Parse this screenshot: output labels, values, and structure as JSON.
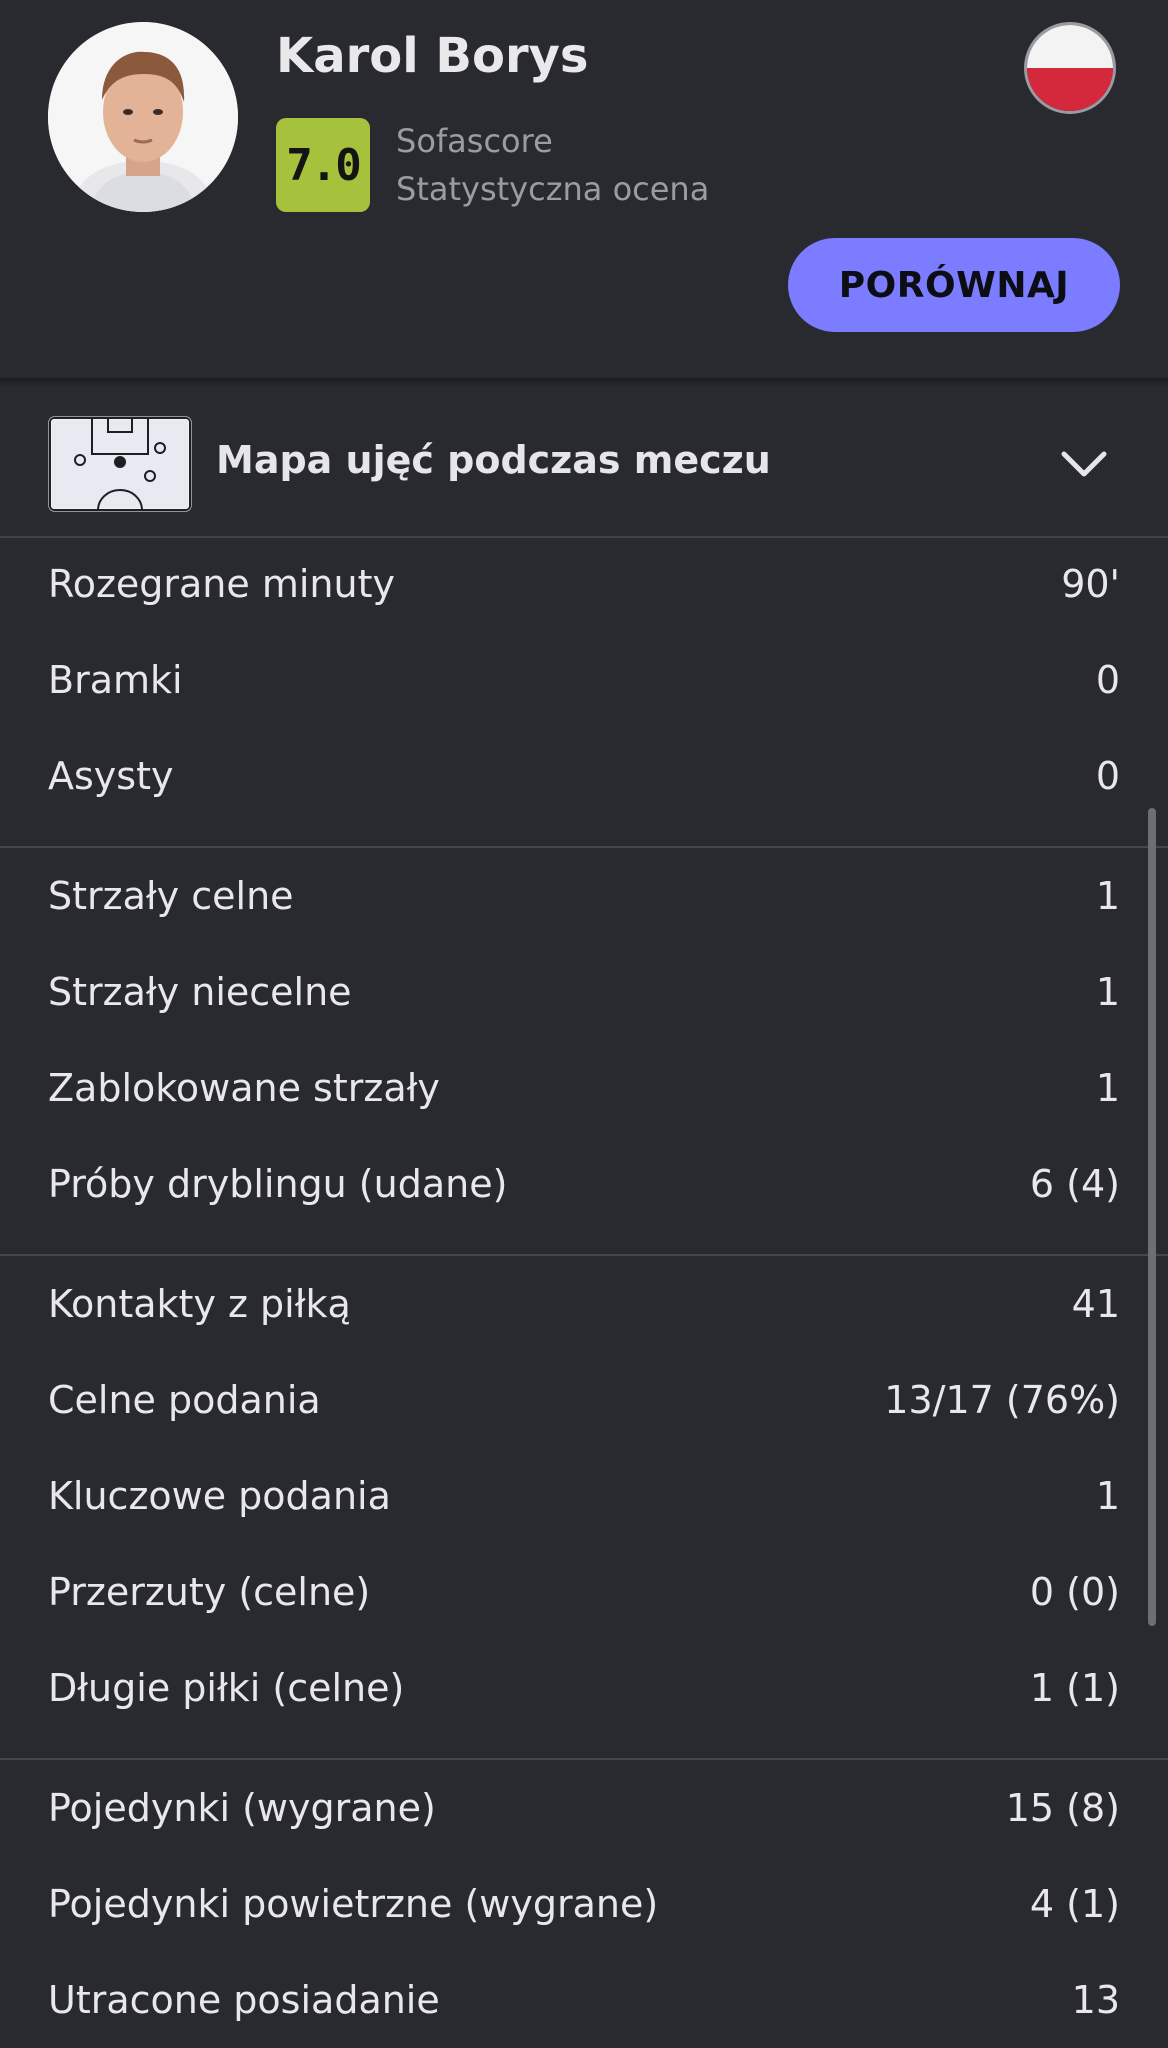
{
  "player": {
    "name": "Karol Borys",
    "rating": "7.0",
    "rating_source": "Sofascore",
    "rating_label": "Statystyczna ocena",
    "compare_label": "PORÓWNAJ",
    "flag_colors": [
      "#f3f3f3",
      "#d4283c"
    ]
  },
  "shotmap": {
    "title": "Mapa ujęć podczas meczu"
  },
  "stats": {
    "group1": [
      {
        "label": "Rozegrane minuty",
        "value": "90'"
      },
      {
        "label": "Bramki",
        "value": "0"
      },
      {
        "label": "Asysty",
        "value": "0"
      }
    ],
    "group2": [
      {
        "label": "Strzały celne",
        "value": "1"
      },
      {
        "label": "Strzały niecelne",
        "value": "1"
      },
      {
        "label": "Zablokowane strzały",
        "value": "1"
      },
      {
        "label": "Próby dryblingu (udane)",
        "value": "6 (4)"
      }
    ],
    "group3": [
      {
        "label": "Kontakty z piłką",
        "value": "41"
      },
      {
        "label": "Celne podania",
        "value": "13/17 (76%)"
      },
      {
        "label": "Kluczowe podania",
        "value": "1"
      },
      {
        "label": "Przerzuty (celne)",
        "value": "0 (0)"
      },
      {
        "label": "Długie piłki (celne)",
        "value": "1 (1)"
      }
    ],
    "group4": [
      {
        "label": "Pojedynki (wygrane)",
        "value": "15 (8)"
      },
      {
        "label": "Pojedynki powietrzne (wygrane)",
        "value": "4 (1)"
      },
      {
        "label": "Utracone posiadanie",
        "value": "13"
      }
    ]
  },
  "colors": {
    "background": "#282a30",
    "rating_badge": "#a6c23c",
    "accent_button": "#7b7cff"
  }
}
